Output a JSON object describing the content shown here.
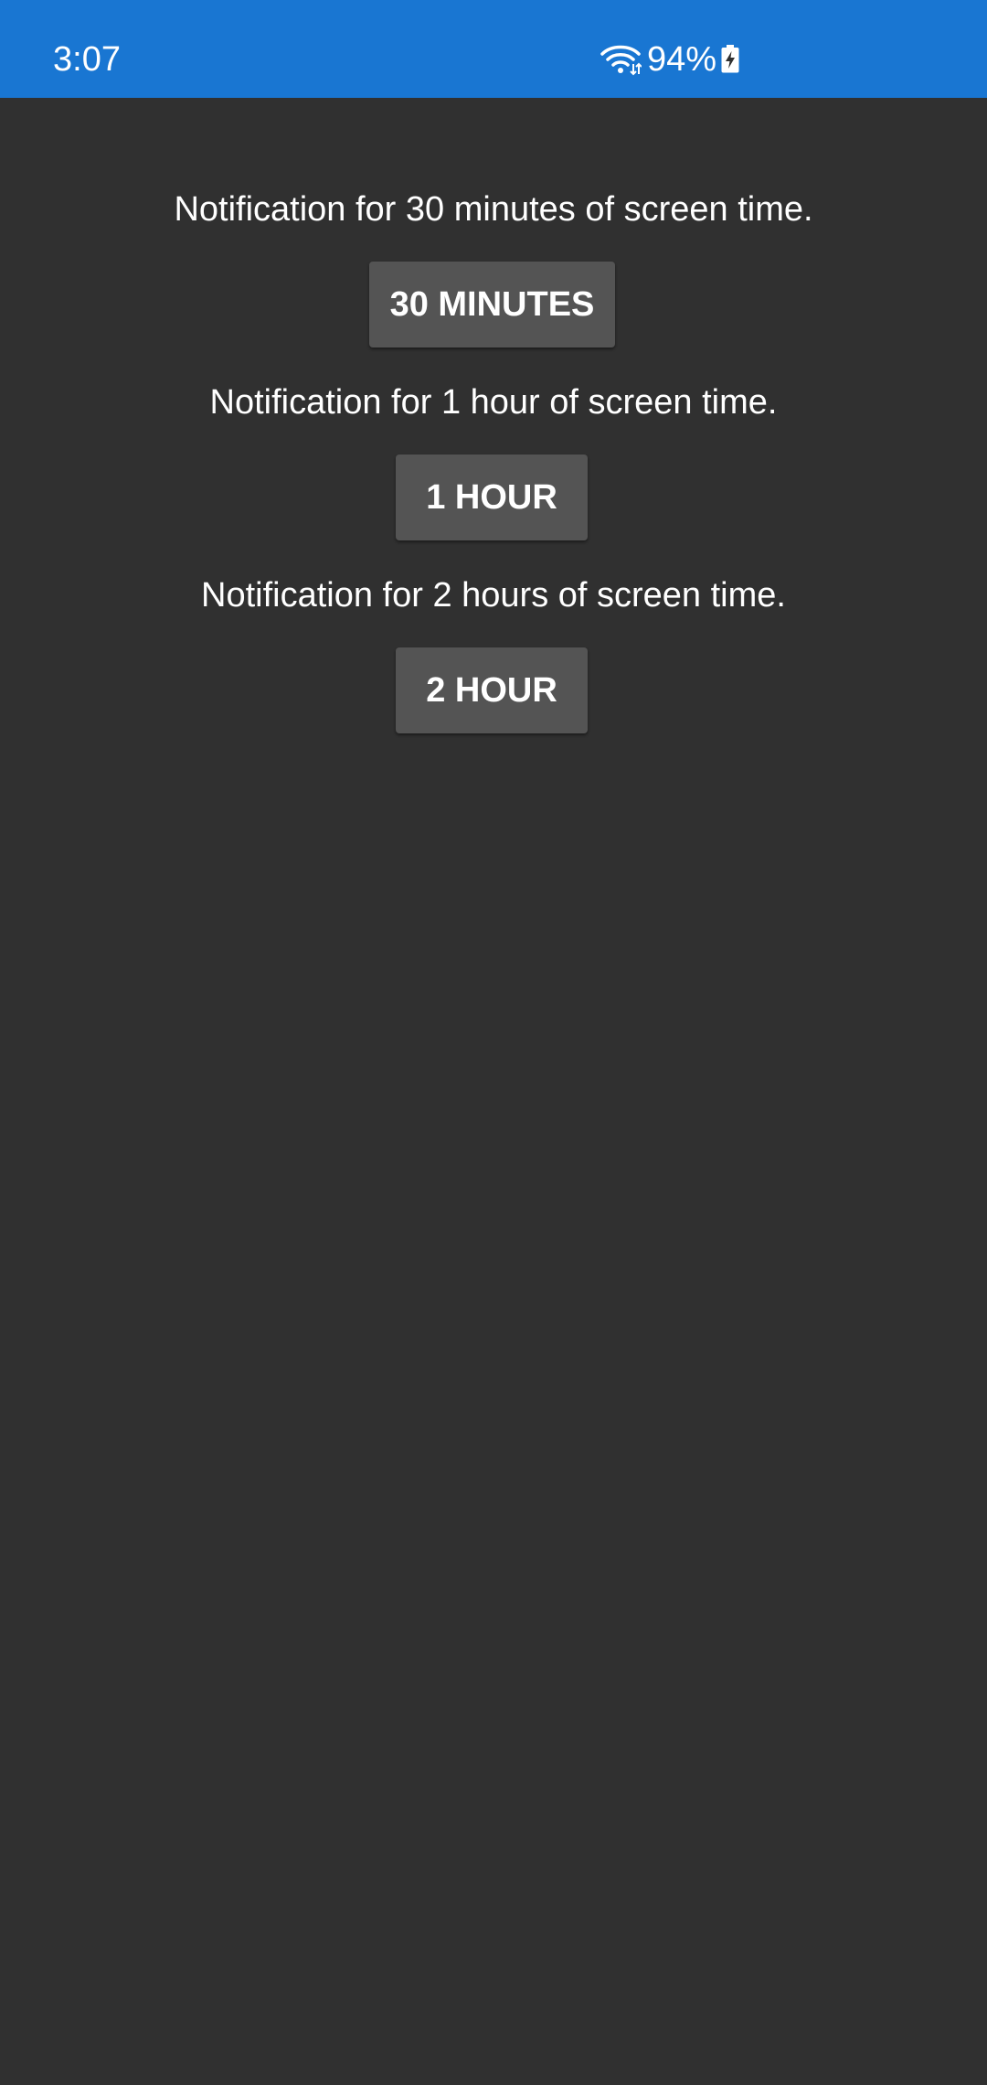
{
  "status_bar": {
    "time": "3:07",
    "battery": "94%",
    "wifi_icon": "wifi-icon",
    "battery_icon": "battery-charging-icon",
    "bg_color": "#1976d2"
  },
  "main": {
    "bg_color": "#303030",
    "items": [
      {
        "description": "Notification for 30 minutes of screen time.",
        "button_label": "30 MINUTES"
      },
      {
        "description": "Notification for 1 hour of screen time.",
        "button_label": "1 HOUR"
      },
      {
        "description": "Notification for 2 hours of screen time.",
        "button_label": "2 HOUR"
      }
    ]
  }
}
